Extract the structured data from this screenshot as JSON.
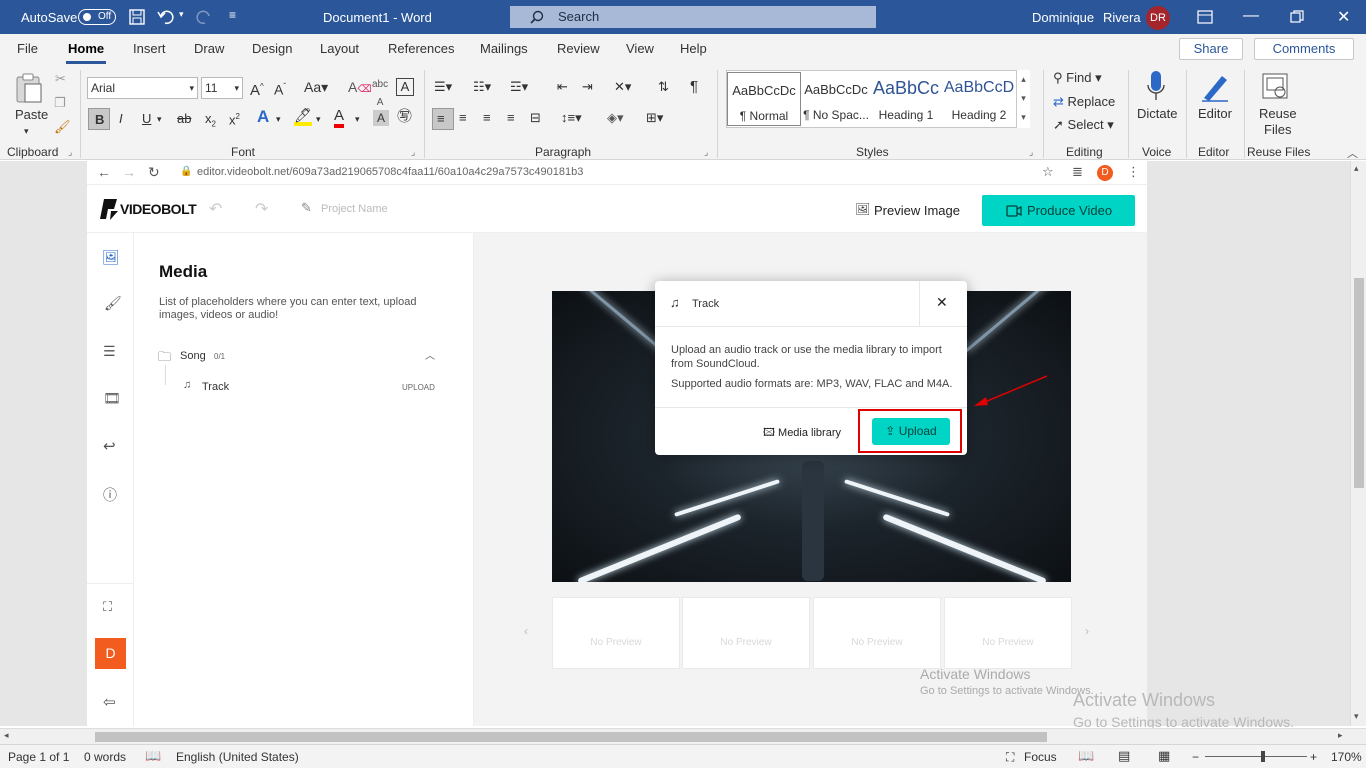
{
  "titlebar": {
    "autosave_label": "AutoSave",
    "autosave_state": "Off",
    "doc_title": "Document1  -  Word",
    "search_placeholder": "Search",
    "user_first": "Dominique",
    "user_last": "Rivera",
    "user_initials": "DR"
  },
  "ribbon_tabs": [
    "File",
    "Home",
    "Insert",
    "Draw",
    "Design",
    "Layout",
    "References",
    "Mailings",
    "Review",
    "View",
    "Help"
  ],
  "ribbon_right": {
    "share": "Share",
    "comments": "Comments"
  },
  "ribbon": {
    "clipboard": {
      "paste": "Paste",
      "label": "Clipboard"
    },
    "font": {
      "name": "Arial",
      "size": "11",
      "label": "Font"
    },
    "paragraph": {
      "label": "Paragraph"
    },
    "styles": {
      "label": "Styles",
      "items": [
        {
          "sample": "AaBbCcDc",
          "name": "¶ Normal"
        },
        {
          "sample": "AaBbCcDc",
          "name": "¶ No Spac..."
        },
        {
          "sample": "AaBbCc",
          "name": "Heading 1"
        },
        {
          "sample": "AaBbCcD",
          "name": "Heading 2"
        }
      ]
    },
    "editing": {
      "find": "Find",
      "replace": "Replace",
      "select": "Select",
      "label": "Editing"
    },
    "voice": {
      "dictate": "Dictate",
      "label": "Voice"
    },
    "editor": {
      "editor": "Editor",
      "label": "Editor"
    },
    "reuse": {
      "reuse1": "Reuse",
      "reuse2": "Files",
      "label": "Reuse Files"
    }
  },
  "browser": {
    "url": "editor.videobolt.net/609a73ad219065708c4faa11/60a10a4c29a7573c490181b3",
    "profile": "D"
  },
  "app": {
    "logo": "VIDEOBOLT",
    "project_name_placeholder": "Project Name",
    "preview_image": "Preview Image",
    "produce_video": "Produce Video",
    "user_initial": "D"
  },
  "media_panel": {
    "title": "Media",
    "description": "List of placeholders where you can enter text, upload images, videos or audio!",
    "folder_name": "Song",
    "folder_count": "0/1",
    "item_name": "Track",
    "item_action": "UPLOAD"
  },
  "thumbnails": [
    "No Preview",
    "No Preview",
    "No Preview",
    "No Preview"
  ],
  "dialog": {
    "title": "Track",
    "line1": "Upload an audio track or use the media library to import from SoundCloud.",
    "line2": "Supported audio formats are: MP3, WAV, FLAC and M4A.",
    "media_library": "Media library",
    "upload": "Upload"
  },
  "watermark": {
    "inner_title": "Activate Windows",
    "inner_sub": "Go to Settings to activate Windows.",
    "outer_title": "Activate Windows",
    "outer_sub": "Go to Settings to activate Windows."
  },
  "statusbar": {
    "page": "Page 1 of 1",
    "words": "0 words",
    "language": "English (United States)",
    "focus": "Focus",
    "zoom": "170%"
  },
  "colors": {
    "word_blue": "#2b579a",
    "teal": "#00d4c4",
    "annotation_red": "#e00000",
    "avatar_red": "#a4262c",
    "app_orange": "#f25c1f"
  }
}
